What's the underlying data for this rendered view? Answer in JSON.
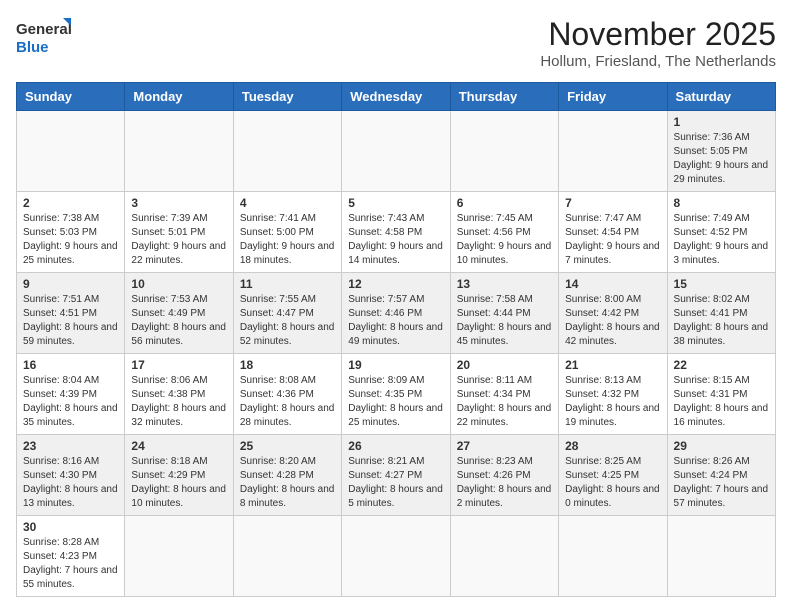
{
  "logo": {
    "line1": "General",
    "line2": "Blue"
  },
  "title": "November 2025",
  "subtitle": "Hollum, Friesland, The Netherlands",
  "weekdays": [
    "Sunday",
    "Monday",
    "Tuesday",
    "Wednesday",
    "Thursday",
    "Friday",
    "Saturday"
  ],
  "weeks": [
    [
      {
        "day": "",
        "info": ""
      },
      {
        "day": "",
        "info": ""
      },
      {
        "day": "",
        "info": ""
      },
      {
        "day": "",
        "info": ""
      },
      {
        "day": "",
        "info": ""
      },
      {
        "day": "",
        "info": ""
      },
      {
        "day": "1",
        "info": "Sunrise: 7:36 AM\nSunset: 5:05 PM\nDaylight: 9 hours and 29 minutes."
      }
    ],
    [
      {
        "day": "2",
        "info": "Sunrise: 7:38 AM\nSunset: 5:03 PM\nDaylight: 9 hours and 25 minutes."
      },
      {
        "day": "3",
        "info": "Sunrise: 7:39 AM\nSunset: 5:01 PM\nDaylight: 9 hours and 22 minutes."
      },
      {
        "day": "4",
        "info": "Sunrise: 7:41 AM\nSunset: 5:00 PM\nDaylight: 9 hours and 18 minutes."
      },
      {
        "day": "5",
        "info": "Sunrise: 7:43 AM\nSunset: 4:58 PM\nDaylight: 9 hours and 14 minutes."
      },
      {
        "day": "6",
        "info": "Sunrise: 7:45 AM\nSunset: 4:56 PM\nDaylight: 9 hours and 10 minutes."
      },
      {
        "day": "7",
        "info": "Sunrise: 7:47 AM\nSunset: 4:54 PM\nDaylight: 9 hours and 7 minutes."
      },
      {
        "day": "8",
        "info": "Sunrise: 7:49 AM\nSunset: 4:52 PM\nDaylight: 9 hours and 3 minutes."
      }
    ],
    [
      {
        "day": "9",
        "info": "Sunrise: 7:51 AM\nSunset: 4:51 PM\nDaylight: 8 hours and 59 minutes."
      },
      {
        "day": "10",
        "info": "Sunrise: 7:53 AM\nSunset: 4:49 PM\nDaylight: 8 hours and 56 minutes."
      },
      {
        "day": "11",
        "info": "Sunrise: 7:55 AM\nSunset: 4:47 PM\nDaylight: 8 hours and 52 minutes."
      },
      {
        "day": "12",
        "info": "Sunrise: 7:57 AM\nSunset: 4:46 PM\nDaylight: 8 hours and 49 minutes."
      },
      {
        "day": "13",
        "info": "Sunrise: 7:58 AM\nSunset: 4:44 PM\nDaylight: 8 hours and 45 minutes."
      },
      {
        "day": "14",
        "info": "Sunrise: 8:00 AM\nSunset: 4:42 PM\nDaylight: 8 hours and 42 minutes."
      },
      {
        "day": "15",
        "info": "Sunrise: 8:02 AM\nSunset: 4:41 PM\nDaylight: 8 hours and 38 minutes."
      }
    ],
    [
      {
        "day": "16",
        "info": "Sunrise: 8:04 AM\nSunset: 4:39 PM\nDaylight: 8 hours and 35 minutes."
      },
      {
        "day": "17",
        "info": "Sunrise: 8:06 AM\nSunset: 4:38 PM\nDaylight: 8 hours and 32 minutes."
      },
      {
        "day": "18",
        "info": "Sunrise: 8:08 AM\nSunset: 4:36 PM\nDaylight: 8 hours and 28 minutes."
      },
      {
        "day": "19",
        "info": "Sunrise: 8:09 AM\nSunset: 4:35 PM\nDaylight: 8 hours and 25 minutes."
      },
      {
        "day": "20",
        "info": "Sunrise: 8:11 AM\nSunset: 4:34 PM\nDaylight: 8 hours and 22 minutes."
      },
      {
        "day": "21",
        "info": "Sunrise: 8:13 AM\nSunset: 4:32 PM\nDaylight: 8 hours and 19 minutes."
      },
      {
        "day": "22",
        "info": "Sunrise: 8:15 AM\nSunset: 4:31 PM\nDaylight: 8 hours and 16 minutes."
      }
    ],
    [
      {
        "day": "23",
        "info": "Sunrise: 8:16 AM\nSunset: 4:30 PM\nDaylight: 8 hours and 13 minutes."
      },
      {
        "day": "24",
        "info": "Sunrise: 8:18 AM\nSunset: 4:29 PM\nDaylight: 8 hours and 10 minutes."
      },
      {
        "day": "25",
        "info": "Sunrise: 8:20 AM\nSunset: 4:28 PM\nDaylight: 8 hours and 8 minutes."
      },
      {
        "day": "26",
        "info": "Sunrise: 8:21 AM\nSunset: 4:27 PM\nDaylight: 8 hours and 5 minutes."
      },
      {
        "day": "27",
        "info": "Sunrise: 8:23 AM\nSunset: 4:26 PM\nDaylight: 8 hours and 2 minutes."
      },
      {
        "day": "28",
        "info": "Sunrise: 8:25 AM\nSunset: 4:25 PM\nDaylight: 8 hours and 0 minutes."
      },
      {
        "day": "29",
        "info": "Sunrise: 8:26 AM\nSunset: 4:24 PM\nDaylight: 7 hours and 57 minutes."
      }
    ],
    [
      {
        "day": "30",
        "info": "Sunrise: 8:28 AM\nSunset: 4:23 PM\nDaylight: 7 hours and 55 minutes."
      },
      {
        "day": "",
        "info": ""
      },
      {
        "day": "",
        "info": ""
      },
      {
        "day": "",
        "info": ""
      },
      {
        "day": "",
        "info": ""
      },
      {
        "day": "",
        "info": ""
      },
      {
        "day": "",
        "info": ""
      }
    ]
  ]
}
